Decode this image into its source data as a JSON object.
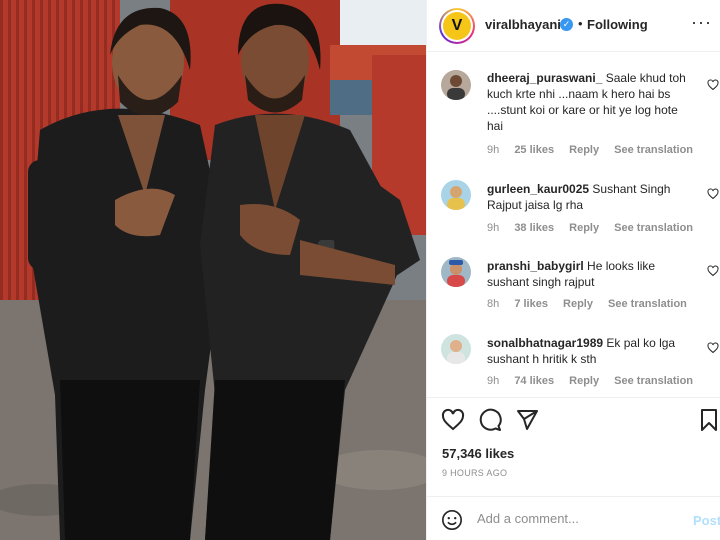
{
  "post": {
    "username": "viralbhayani",
    "follow_state": "Following",
    "separator": "•",
    "avatar_letter": "V",
    "image_alt": "Two men in black shirts posing with finger guns"
  },
  "comments": [
    {
      "username": "dheeraj_puraswani_",
      "text": "Saale khud toh kuch krte nhi ...naam k hero hai bs ....stunt koi or kare or hit ye log hote hai",
      "time": "9h",
      "likes": "25 likes",
      "reply": "Reply",
      "translation": "See translation"
    },
    {
      "username": "gurleen_kaur0025",
      "text": "Sushant Singh Rajput jaisa lg rha",
      "time": "9h",
      "likes": "38 likes",
      "reply": "Reply",
      "translation": "See translation"
    },
    {
      "username": "pranshi_babygirl",
      "text": "He looks like sushant singh rajput",
      "time": "8h",
      "likes": "7 likes",
      "reply": "Reply",
      "translation": "See translation"
    },
    {
      "username": "sonalbhatnagar1989",
      "text": "Ek pal ko lga sushant h hritik k sth",
      "time": "9h",
      "likes": "74 likes",
      "reply": "Reply",
      "translation": "See translation"
    }
  ],
  "engagement": {
    "likes": "57,346 likes",
    "time_ago": "9 HOURS AGO"
  },
  "composer": {
    "placeholder": "Add a comment...",
    "post_label": "Post"
  },
  "colors": {
    "verified": "#3897f0",
    "post_button_disabled": "#b2dffc",
    "meta_gray": "#8e8e8e"
  },
  "icons": [
    "heart-icon",
    "comment-icon",
    "share-icon",
    "bookmark-icon",
    "emoji-icon",
    "verified-icon",
    "more-icon"
  ]
}
